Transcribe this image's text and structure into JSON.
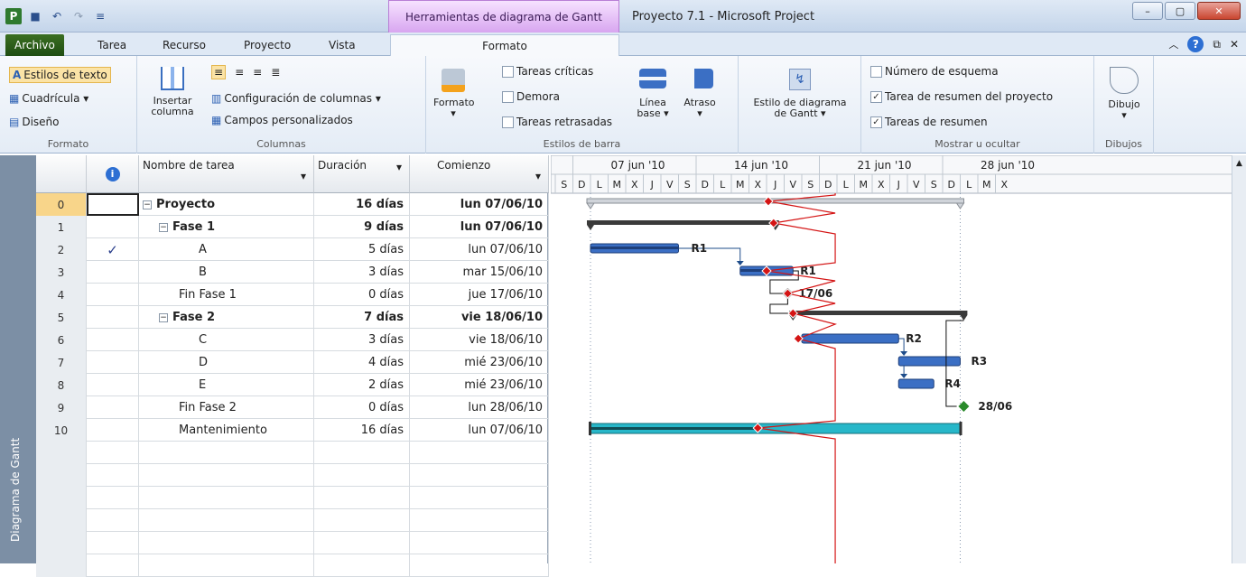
{
  "window": {
    "title": "Proyecto 7.1  -  Microsoft Project",
    "context_tab": "Herramientas de diagrama de Gantt",
    "context_subtab": "Formato"
  },
  "tabs": [
    {
      "label": "Archivo"
    },
    {
      "label": "Tarea"
    },
    {
      "label": "Recurso"
    },
    {
      "label": "Proyecto"
    },
    {
      "label": "Vista"
    },
    {
      "label": "Formato"
    }
  ],
  "ribbon": {
    "formato": {
      "label": "Formato",
      "estilos_texto": "Estilos de texto",
      "cuadricula": "Cuadrícula ▾",
      "diseno": "Diseño"
    },
    "columnas": {
      "label": "Columnas",
      "insertar": "Insertar",
      "columna": "columna",
      "config": "Configuración de columnas ▾",
      "campos": "Campos personalizados"
    },
    "estilos_barra": {
      "label": "Estilos de barra",
      "formato_btn": "Formato",
      "criticas": "Tareas críticas",
      "demora": "Demora",
      "retrasadas": "Tareas retrasadas",
      "linea": "Línea",
      "base": "base ▾",
      "atraso": "Atraso"
    },
    "estilo_diagrama": {
      "line1": "Estilo de diagrama",
      "line2": "de Gantt ▾"
    },
    "mostrar": {
      "label": "Mostrar u ocultar",
      "esquema": "Número de esquema",
      "resumen_proyecto": "Tarea de resumen del proyecto",
      "resumen": "Tareas de resumen",
      "esquema_checked": false,
      "resumen_proyecto_checked": true,
      "resumen_checked": true
    },
    "dibujos": {
      "label": "Dibujos",
      "dibujo": "Dibujo"
    }
  },
  "sidebar_label": "Diagrama de Gantt",
  "table": {
    "headers": {
      "nombre": "Nombre de tarea",
      "duracion": "Duración",
      "comienzo": "Comienzo"
    },
    "rows": [
      {
        "id": "0",
        "name": "Proyecto",
        "dur": "16 días",
        "start": "lun 07/06/10",
        "level": 0,
        "summary": true,
        "indicator": ""
      },
      {
        "id": "1",
        "name": "Fase 1",
        "dur": "9 días",
        "start": "lun 07/06/10",
        "level": 1,
        "summary": true,
        "indicator": ""
      },
      {
        "id": "2",
        "name": "A",
        "dur": "5 días",
        "start": "lun 07/06/10",
        "level": 2,
        "summary": false,
        "indicator": "✓"
      },
      {
        "id": "3",
        "name": "B",
        "dur": "3 días",
        "start": "mar 15/06/10",
        "level": 2,
        "summary": false,
        "indicator": ""
      },
      {
        "id": "4",
        "name": "Fin Fase 1",
        "dur": "0 días",
        "start": "jue 17/06/10",
        "level": 1,
        "summary": false,
        "indicator": ""
      },
      {
        "id": "5",
        "name": "Fase 2",
        "dur": "7 días",
        "start": "vie 18/06/10",
        "level": 1,
        "summary": true,
        "indicator": ""
      },
      {
        "id": "6",
        "name": "C",
        "dur": "3 días",
        "start": "vie 18/06/10",
        "level": 2,
        "summary": false,
        "indicator": ""
      },
      {
        "id": "7",
        "name": "D",
        "dur": "4 días",
        "start": "mié 23/06/10",
        "level": 2,
        "summary": false,
        "indicator": ""
      },
      {
        "id": "8",
        "name": "E",
        "dur": "2 días",
        "start": "mié 23/06/10",
        "level": 2,
        "summary": false,
        "indicator": ""
      },
      {
        "id": "9",
        "name": "Fin Fase 2",
        "dur": "0 días",
        "start": "lun 28/06/10",
        "level": 1,
        "summary": false,
        "indicator": ""
      },
      {
        "id": "10",
        "name": "Mantenimiento",
        "dur": "16 días",
        "start": "lun 07/06/10",
        "level": 1,
        "summary": false,
        "indicator": ""
      }
    ]
  },
  "timescale": {
    "weeks": [
      "07 jun '10",
      "14 jun '10",
      "21 jun '10",
      "28 jun '10"
    ],
    "days": [
      "S",
      "D",
      "L",
      "M",
      "X",
      "J",
      "V",
      "S",
      "D",
      "L",
      "M",
      "X",
      "J",
      "V",
      "S",
      "D",
      "L",
      "M",
      "X",
      "J",
      "V",
      "S",
      "D",
      "L",
      "M",
      "X"
    ]
  },
  "bar_labels": {
    "a": "R1",
    "b": "R1",
    "m1": "17/06",
    "c": "R2",
    "d": "R3",
    "e": "R4",
    "m2": "28/06"
  },
  "colors": {
    "task_bar": "#3b6fc4",
    "summary_bar": "#3a3a3a",
    "maint_bar": "#27b7c9",
    "status_line": "#d41414",
    "milestone_done": "#2a8a2a"
  }
}
